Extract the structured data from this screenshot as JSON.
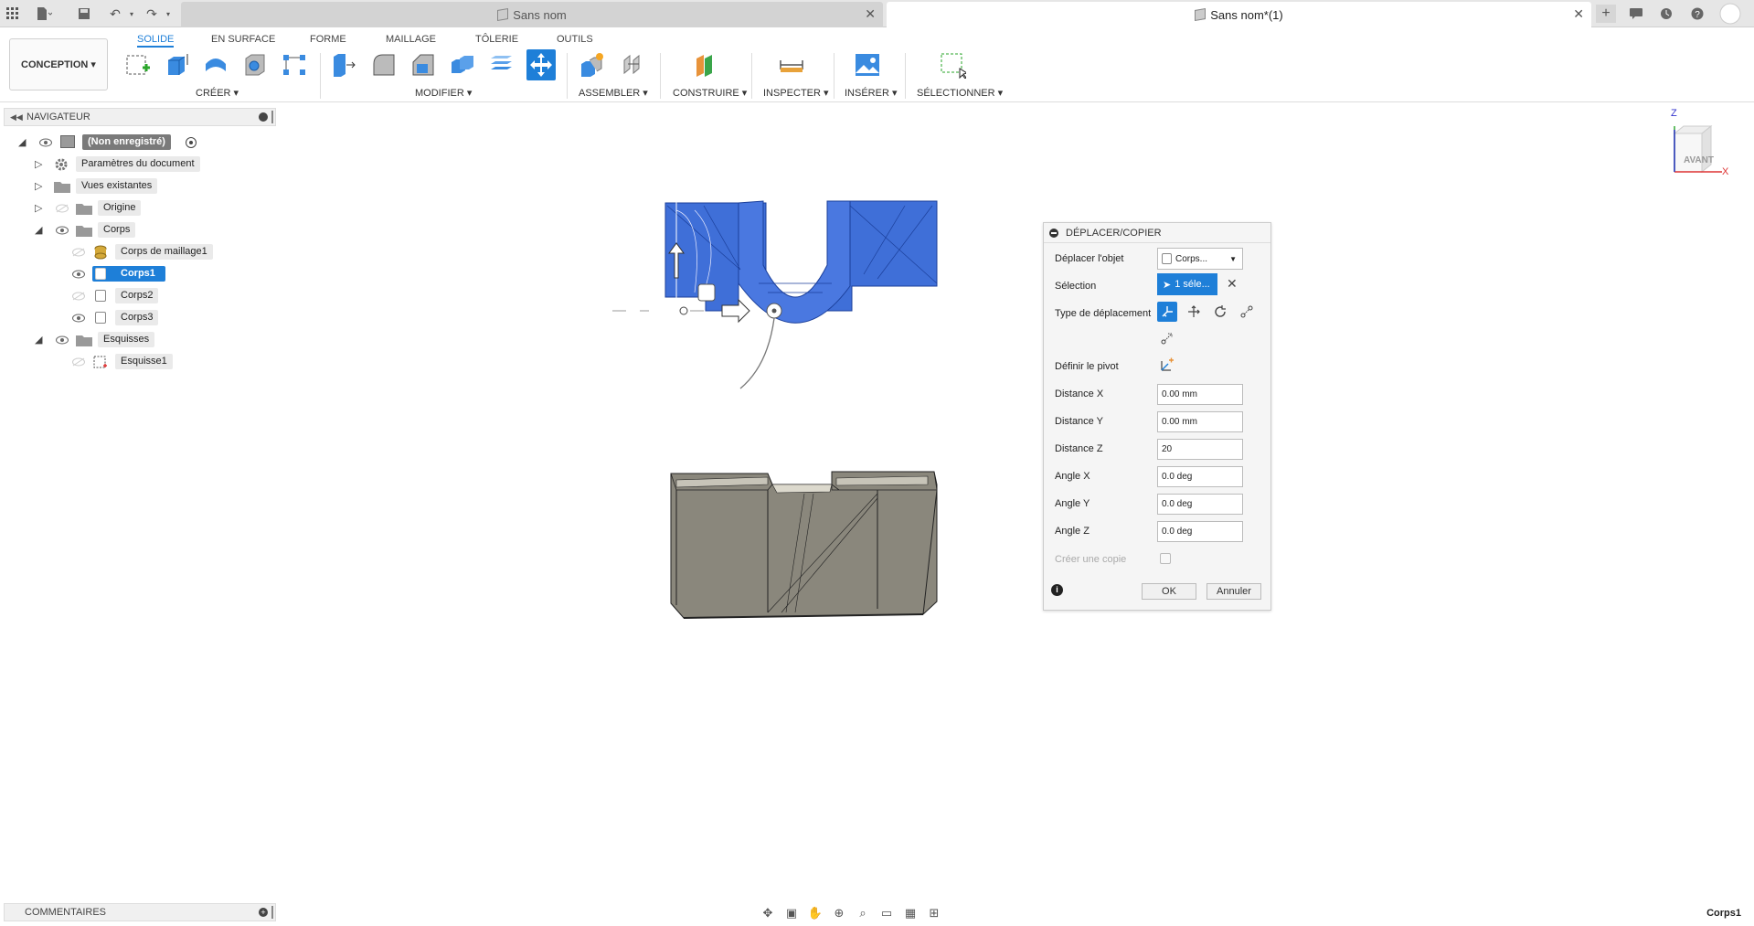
{
  "titlebar": {
    "tabs": [
      {
        "label": "Sans nom",
        "active": false
      },
      {
        "label": "Sans nom*(1)",
        "active": true
      }
    ]
  },
  "ribbon": {
    "workspace": "CONCEPTION ▾",
    "tabs": [
      "SOLIDE",
      "EN SURFACE",
      "FORME",
      "MAILLAGE",
      "TÔLERIE",
      "OUTILS"
    ],
    "groups": {
      "create": "CRÉER ▾",
      "modify": "MODIFIER ▾",
      "assemble": "ASSEMBLER ▾",
      "construct": "CONSTRUIRE ▾",
      "inspect": "INSPECTER ▾",
      "insert": "INSÉRER ▾",
      "select": "SÉLECTIONNER ▾"
    }
  },
  "navigator": {
    "title": "NAVIGATEUR",
    "root": "(Non enregistré)",
    "doc_params": "Paramètres du document",
    "views": "Vues existantes",
    "origin": "Origine",
    "bodies": "Corps",
    "mesh_body": "Corps de maillage1",
    "body1": "Corps1",
    "body2": "Corps2",
    "body3": "Corps3",
    "sketches": "Esquisses",
    "sketch1": "Esquisse1"
  },
  "dialog": {
    "title": "DÉPLACER/COPIER",
    "move_object_label": "Déplacer l'objet",
    "move_object_value": "Corps...",
    "selection_label": "Sélection",
    "selection_value": "1 séle...",
    "move_type_label": "Type de déplacement",
    "pivot_label": "Définir le pivot",
    "dist_x_label": "Distance X",
    "dist_x": "0.00 mm",
    "dist_y_label": "Distance Y",
    "dist_y": "0.00 mm",
    "dist_z_label": "Distance Z",
    "dist_z": "20",
    "angle_x_label": "Angle X",
    "angle_x": "0.0 deg",
    "angle_y_label": "Angle Y",
    "angle_y": "0.0 deg",
    "angle_z_label": "Angle Z",
    "angle_z": "0.0 deg",
    "copy_label": "Créer une copie",
    "ok": "OK",
    "cancel": "Annuler"
  },
  "viewcube": {
    "face": "AVANT",
    "axis_z": "Z",
    "axis_x": "X"
  },
  "comments": "COMMENTAIRES",
  "status": "Corps1",
  "colors": {
    "accent": "#1e7fd8",
    "selected_body": "#3f6fd8",
    "body_gray": "#8a877c"
  }
}
